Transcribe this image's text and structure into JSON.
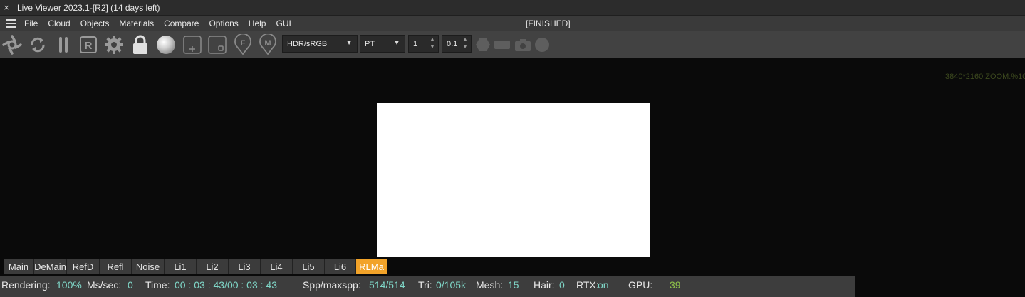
{
  "window": {
    "close_glyph": "×",
    "title": "Live Viewer 2023.1-[R2] (14 days left)"
  },
  "menu": {
    "items": [
      "File",
      "Cloud",
      "Objects",
      "Materials",
      "Compare",
      "Options",
      "Help",
      "GUI"
    ],
    "status": "[FINISHED]"
  },
  "toolbar": {
    "icons": [
      "recenter-icon",
      "restart-render-icon",
      "pause-icon",
      "region-render-icon",
      "settings-gear-icon",
      "lock-icon",
      "material-sphere-icon",
      "add-region-icon",
      "small-region-icon",
      "focus-pick-icon",
      "material-pick-icon"
    ],
    "color_space": "HDR/sRGB",
    "kernel": "PT",
    "spin1": "1",
    "spin2": "0.1",
    "extra_icons": [
      "hexagon-icon",
      "rectangle-icon",
      "camera-icon",
      "circle-icon"
    ]
  },
  "viewport": {
    "resolution_info": "3840*2160 ZOOM:%10"
  },
  "pass_tabs": [
    "Main",
    "DeMain",
    "RefD",
    "Refl",
    "Noise",
    "Li1",
    "Li2",
    "Li3",
    "Li4",
    "Li5",
    "Li6",
    "RLMa"
  ],
  "status": {
    "rendering_label": "Rendering:",
    "rendering_value": "100%",
    "mssec_label": "Ms/sec:",
    "mssec_value": "0",
    "time_label": "Time:",
    "time_value": "00 : 03 : 43/00 : 03 : 43",
    "spp_label": "Spp/maxspp:",
    "spp_value": "514/514",
    "tri_label": "Tri:",
    "tri_value": "0/105k",
    "mesh_label": "Mesh:",
    "mesh_value": "15",
    "hair_label": "Hair:",
    "hair_value": "0",
    "rtx_label": "RTX:",
    "rtx_value": "on",
    "gpu_label": "GPU:",
    "gpu_value": "39"
  },
  "colors": {
    "accent_tab": "#f2a329",
    "value_text": "#7fd6c7",
    "gpu_text": "#8fc24a"
  }
}
